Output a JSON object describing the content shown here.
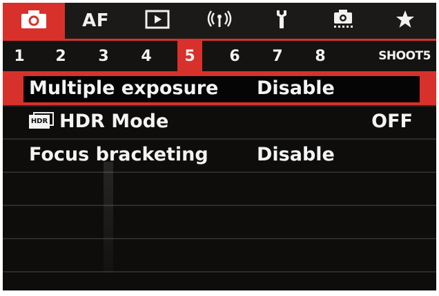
{
  "tabs": [
    {
      "name": "camera-icon",
      "label": "",
      "active": true
    },
    {
      "name": "af-tab",
      "label": "AF",
      "active": false
    },
    {
      "name": "playback-icon",
      "label": "",
      "active": false
    },
    {
      "name": "wireless-icon",
      "label": "",
      "active": false
    },
    {
      "name": "wrench-icon",
      "label": "",
      "active": false
    },
    {
      "name": "custom-camera-icon",
      "label": "",
      "active": false
    },
    {
      "name": "star-icon",
      "label": "",
      "active": false
    }
  ],
  "pages": [
    "1",
    "2",
    "3",
    "4",
    "5",
    "6",
    "7",
    "8"
  ],
  "active_page": "5",
  "page_name": "SHOOT5",
  "menu": {
    "items": [
      {
        "label": "Multiple exposure",
        "value": "Disable",
        "selected": true
      },
      {
        "label": "HDR Mode",
        "value": "OFF",
        "selected": false,
        "icon": "hdr-icon"
      },
      {
        "label": "Focus bracketing",
        "value": "Disable",
        "selected": false
      }
    ],
    "hdr_icon_text": "HDR"
  },
  "colors": {
    "accent": "#d8312c",
    "background": "#0e0d0c",
    "text": "#f3f3f3"
  }
}
